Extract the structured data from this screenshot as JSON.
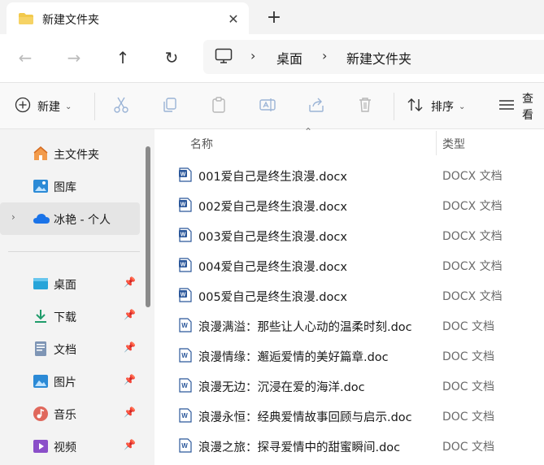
{
  "window": {
    "tab_title": "新建文件夹",
    "close_glyph": "✕",
    "new_tab_glyph": "+"
  },
  "nav": {
    "back_glyph": "←",
    "forward_glyph": "→",
    "up_glyph": "↑",
    "refresh_glyph": "↻",
    "chevron": "›",
    "breadcrumb": [
      "桌面",
      "新建文件夹"
    ]
  },
  "toolbar": {
    "new_label": "新建",
    "sort_label": "排序",
    "view_label": "查看"
  },
  "sidebar": {
    "items": [
      {
        "label": "主文件夹",
        "icon": "home-icon"
      },
      {
        "label": "图库",
        "icon": "gallery-icon"
      },
      {
        "label": "冰艳 - 个人",
        "icon": "onedrive-icon"
      },
      {
        "label": "桌面",
        "icon": "desktop-icon"
      },
      {
        "label": "下载",
        "icon": "download-icon"
      },
      {
        "label": "文档",
        "icon": "documents-icon"
      },
      {
        "label": "图片",
        "icon": "pictures-icon"
      },
      {
        "label": "音乐",
        "icon": "music-icon"
      },
      {
        "label": "视频",
        "icon": "videos-icon"
      }
    ]
  },
  "columns": {
    "name": "名称",
    "type": "类型"
  },
  "files": [
    {
      "name": "001爱自己是终生浪漫.docx",
      "type": "DOCX 文档",
      "icon": "word-docx-icon"
    },
    {
      "name": "002爱自己是终生浪漫.docx",
      "type": "DOCX 文档",
      "icon": "word-docx-icon"
    },
    {
      "name": "003爱自己是终生浪漫.docx",
      "type": "DOCX 文档",
      "icon": "word-docx-icon"
    },
    {
      "name": "004爱自己是终生浪漫.docx",
      "type": "DOCX 文档",
      "icon": "word-docx-icon"
    },
    {
      "name": "005爱自己是终生浪漫.docx",
      "type": "DOCX 文档",
      "icon": "word-docx-icon"
    },
    {
      "name": "浪漫满溢：那些让人心动的温柔时刻.doc",
      "type": "DOC 文档",
      "icon": "word-doc-icon"
    },
    {
      "name": "浪漫情缘：邂逅爱情的美好篇章.doc",
      "type": "DOC 文档",
      "icon": "word-doc-icon"
    },
    {
      "name": "浪漫无边：沉浸在爱的海洋.doc",
      "type": "DOC 文档",
      "icon": "word-doc-icon"
    },
    {
      "name": "浪漫永恒：经典爱情故事回顾与启示.doc",
      "type": "DOC 文档",
      "icon": "word-doc-icon"
    },
    {
      "name": "浪漫之旅：探寻爱情中的甜蜜瞬间.doc",
      "type": "DOC 文档",
      "icon": "word-doc-icon"
    }
  ],
  "colors": {
    "accent": "#2b6cd6",
    "folder": "#f2c94c"
  }
}
